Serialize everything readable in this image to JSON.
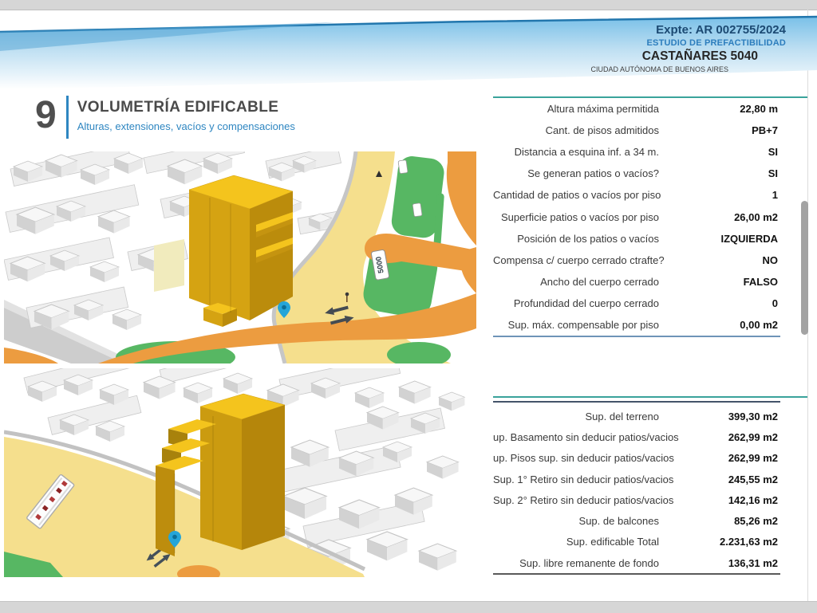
{
  "header": {
    "expediente": "Expte: AR 002755/2024",
    "document_type": "ESTUDIO DE PREFACTIBILIDAD",
    "address": "CASTAÑARES 5040",
    "city": "CIUDAD AUTÓNOMA DE BUENOS AIRES"
  },
  "section": {
    "number": "9",
    "title": "VOLUMETRÍA EDIFICABLE",
    "subtitle": "Alturas, extensiones, vacíos y compensaciones"
  },
  "parameters_table": {
    "rows": [
      {
        "label": "Altura máxima permitida",
        "value": "22,80 m"
      },
      {
        "label": "Cant. de pisos admitidos",
        "value": "PB+7"
      },
      {
        "label": "Distancia a esquina inf. a 34 m.",
        "value": "SI"
      },
      {
        "label": "Se generan patios o vacíos?",
        "value": "SI"
      },
      {
        "label": "Cantidad de patios o vacíos por piso",
        "value": "1"
      },
      {
        "label": "Superficie patios o vacíos por piso",
        "value": "26,00 m2"
      },
      {
        "label": "Posición de los patios o vacíos",
        "value": "IZQUIERDA"
      },
      {
        "label": "Compensa c/ cuerpo cerrado ctrafte?",
        "value": "NO"
      },
      {
        "label": "Ancho del cuerpo cerrado",
        "value": "FALSO"
      },
      {
        "label": "Profundidad del cuerpo cerrado",
        "value": "0"
      },
      {
        "label": "Sup. máx. compensable por piso",
        "value": "0,00 m2"
      }
    ]
  },
  "surfaces_table": {
    "rows": [
      {
        "label": "Sup. del terreno",
        "value": "399,30 m2"
      },
      {
        "label": "up. Basamento sin deducir patios/vacios",
        "value": "262,99 m2"
      },
      {
        "label": "up. Pisos sup. sin deducir patios/vacios",
        "value": "262,99 m2"
      },
      {
        "label": "Sup. 1° Retiro sin deducir patios/vacios",
        "value": "245,55 m2"
      },
      {
        "label": "Sup. 2° Retiro sin deducir patios/vacios",
        "value": "142,16 m2"
      },
      {
        "label": "Sup. de balcones",
        "value": "85,26 m2"
      },
      {
        "label": "Sup. edificable Total",
        "value": "2.231,63 m2"
      },
      {
        "label": "Sup. libre remanente de fondo",
        "value": "136,31 m2"
      }
    ]
  },
  "maps": {
    "top": {
      "road_number": "5000"
    },
    "bottom": {}
  },
  "colors": {
    "accent_blue": "#2e86c1",
    "header_navy": "#1c4a73",
    "teal_rule": "#3aa39b",
    "slate_rule": "#6e94b8",
    "dark_rule": "#44546a",
    "building_gold": "#d5a312",
    "map_green": "#57b763",
    "map_orange": "#ec9c40",
    "road_yellow": "#f5df8d",
    "pin_blue": "#25a5d8"
  }
}
